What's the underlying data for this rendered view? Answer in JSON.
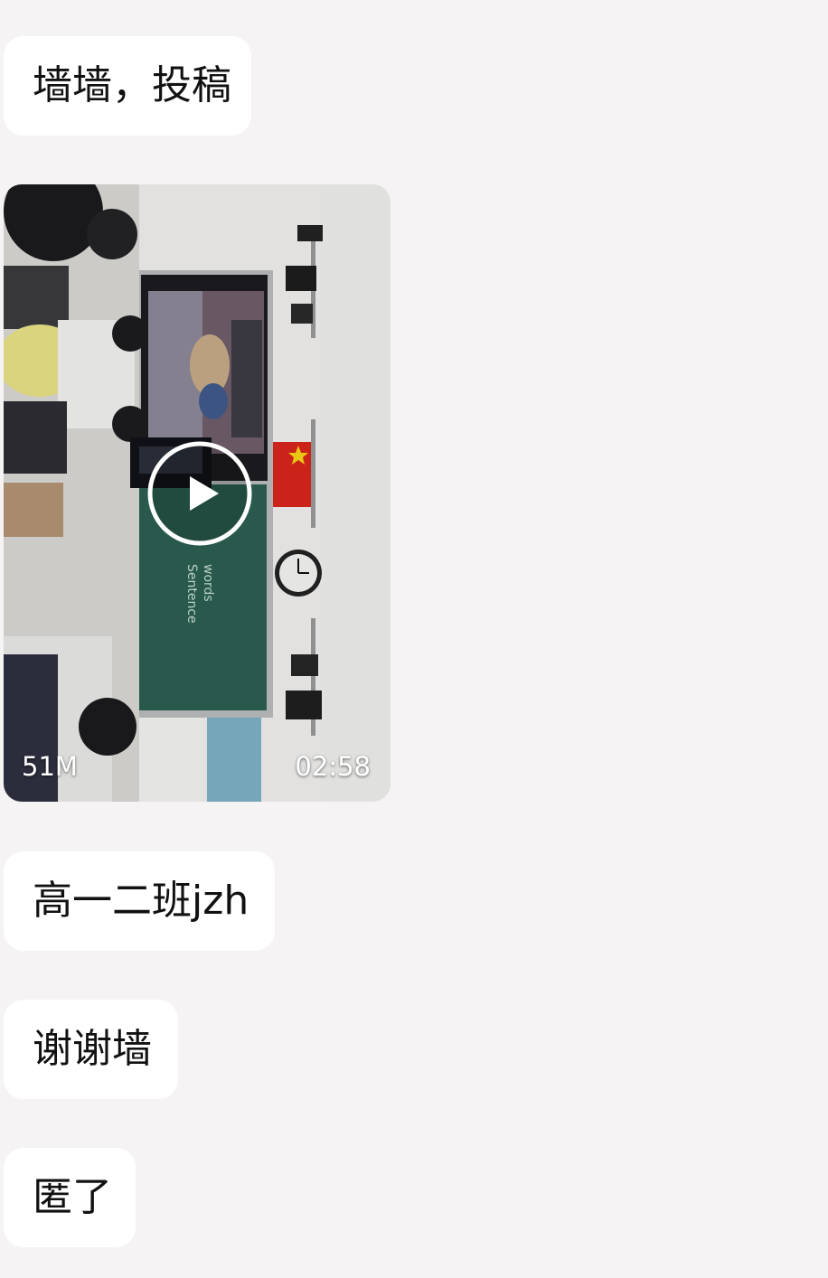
{
  "messages": [
    {
      "text": "墙墙，投稿"
    },
    {
      "video": {
        "size": "51M",
        "duration": "02:58",
        "play_icon": "play-circle-icon"
      }
    },
    {
      "text": "高一二班jzh"
    },
    {
      "text": "谢谢墙"
    },
    {
      "text": "匿了"
    }
  ],
  "colors": {
    "background": "#f5f3f4",
    "bubble": "#ffffff",
    "text": "#111111",
    "overlay_text": "#ffffff"
  }
}
